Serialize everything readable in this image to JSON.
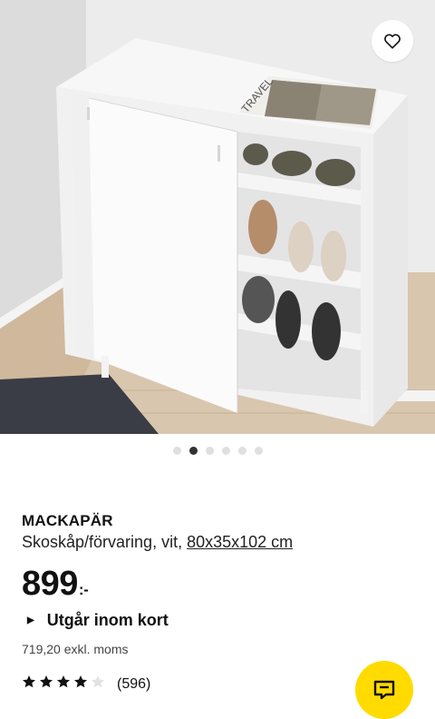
{
  "product": {
    "name": "MACKAPÄR",
    "description": "Skoskåp/förvaring, vit, ",
    "dimensions_link": "80x35x102 cm",
    "price_main": "899",
    "price_suffix": ":-",
    "stock_status": "Utgår inom kort",
    "price_ex_vat": "719,20 exkl. moms"
  },
  "rating": {
    "stars": 4,
    "max_stars": 5,
    "count": "(596)"
  },
  "magazine": {
    "title": "TRAVEL"
  },
  "carousel": {
    "total": 6,
    "active_index": 1
  },
  "colors": {
    "accent_yellow": "#ffdb00",
    "text_dark": "#111111"
  },
  "icons": {
    "favorite": "heart-icon",
    "chat": "chat-icon",
    "stock_arrow": "triangle-right-icon"
  }
}
